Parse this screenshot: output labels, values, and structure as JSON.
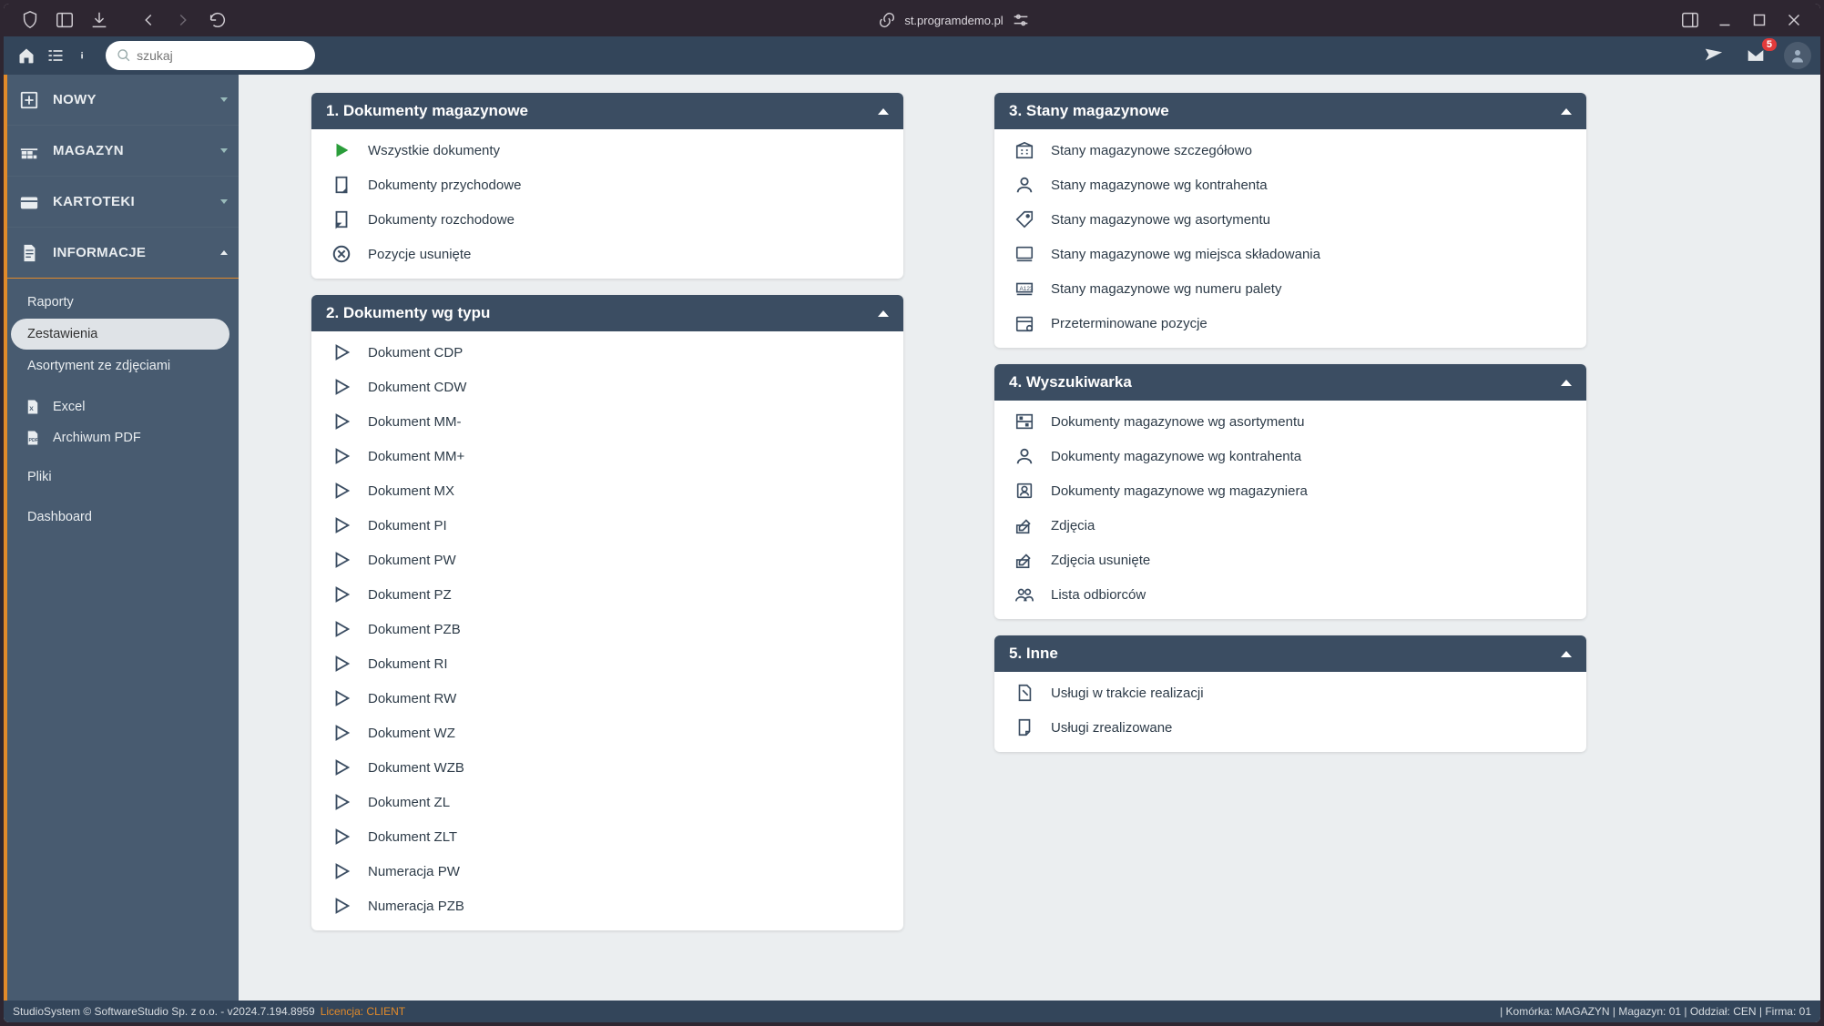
{
  "chrome": {
    "url": "st.programdemo.pl"
  },
  "appbar": {
    "search_placeholder": "szukaj",
    "mail_count": "5"
  },
  "sidebar": {
    "main": [
      {
        "label": "NOWY",
        "expanded": false
      },
      {
        "label": "MAGAZYN",
        "expanded": false
      },
      {
        "label": "KARTOTEKI",
        "expanded": false
      },
      {
        "label": "INFORMACJE",
        "expanded": true
      }
    ],
    "sub": {
      "raporty": "Raporty",
      "zestawienia": "Zestawienia",
      "asortyment": "Asortyment ze zdjęciami",
      "excel": "Excel",
      "archiwum": "Archiwum PDF",
      "pliki": "Pliki",
      "dashboard": "Dashboard"
    }
  },
  "panels": {
    "p1": {
      "title": "1. Dokumenty magazynowe",
      "items": [
        "Wszystkie dokumenty",
        "Dokumenty przychodowe",
        "Dokumenty rozchodowe",
        "Pozycje usunięte"
      ]
    },
    "p2": {
      "title": "2. Dokumenty wg typu",
      "items": [
        "Dokument CDP",
        "Dokument CDW",
        "Dokument MM-",
        "Dokument MM+",
        "Dokument MX",
        "Dokument PI",
        "Dokument PW",
        "Dokument PZ",
        "Dokument PZB",
        "Dokument RI",
        "Dokument RW",
        "Dokument WZ",
        "Dokument WZB",
        "Dokument ZL",
        "Dokument ZLT",
        "Numeracja PW",
        "Numeracja PZB"
      ]
    },
    "p3": {
      "title": "3. Stany magazynowe",
      "items": [
        "Stany magazynowe szczegółowo",
        "Stany magazynowe wg kontrahenta",
        "Stany magazynowe wg asortymentu",
        "Stany magazynowe wg miejsca składowania",
        "Stany magazynowe wg numeru palety",
        "Przeterminowane pozycje"
      ]
    },
    "p4": {
      "title": "4. Wyszukiwarka",
      "items": [
        "Dokumenty magazynowe wg asortymentu",
        "Dokumenty magazynowe wg kontrahenta",
        "Dokumenty magazynowe wg magazyniera",
        "Zdjęcia",
        "Zdjęcia usunięte",
        "Lista odbiorców"
      ]
    },
    "p5": {
      "title": "5. Inne",
      "items": [
        "Usługi w trakcie realizacji",
        "Usługi zrealizowane"
      ]
    }
  },
  "footer": {
    "copyright": "StudioSystem © SoftwareStudio Sp. z o.o. - v2024.7.194.8959",
    "license_label": "Licencja: ",
    "license_value": "CLIENT",
    "status": "| Komórka: MAGAZYN | Magazyn: 01 | Oddział: CEN | Firma: 01"
  }
}
